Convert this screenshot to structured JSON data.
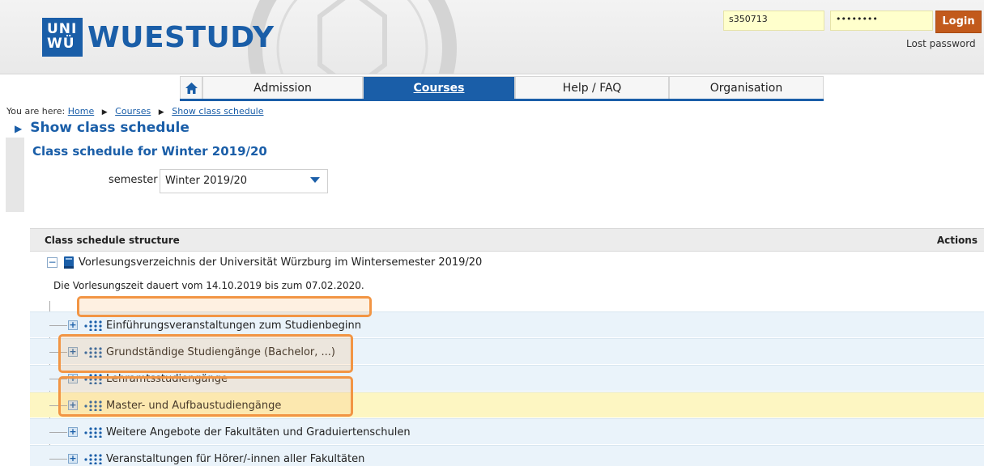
{
  "header": {
    "logo_box": "UNI WÜ",
    "logo_text": "WUESTUDY",
    "username_value": "s350713",
    "password_value": "••••••••",
    "login_label": "Login",
    "lost_password": "Lost password"
  },
  "nav": {
    "items": [
      {
        "label": "Admission"
      },
      {
        "label": "Courses"
      },
      {
        "label": "Help / FAQ"
      },
      {
        "label": "Organisation"
      }
    ]
  },
  "breadcrumb": {
    "prefix": "You are here:",
    "items": [
      "Home",
      "Courses",
      "Show class schedule"
    ]
  },
  "page": {
    "title": "Show class schedule",
    "section_title": "Class schedule for Winter 2019/20",
    "semester_label": "semester",
    "semester_value": "Winter 2019/20"
  },
  "structure": {
    "header_label": "Class schedule structure",
    "actions_label": "Actions",
    "root_label": "Vorlesungsverzeichnis der Universität Würzburg im Wintersemester 2019/20",
    "root_desc": "Die Vorlesungszeit dauert vom 14.10.2019 bis zum 07.02.2020.",
    "rows": [
      {
        "label": "Einführungsveranstaltungen zum Studienbeginn"
      },
      {
        "label": "Grundständige Studiengänge (Bachelor, ...)"
      },
      {
        "label": "Lehramtsstudiengänge"
      },
      {
        "label": "Master- und Aufbaustudiengänge"
      },
      {
        "label": "Weitere Angebote der Fakultäten und Graduiertenschulen"
      },
      {
        "label": "Veranstaltungen für Hörer/-innen aller Fakultäten"
      }
    ]
  },
  "colors": {
    "brand_blue": "#1a5ea8",
    "login_orange": "#c25a1c",
    "highlight_orange": "#f29544",
    "row_blue_bg": "#eaf3fa",
    "row_yellow_bg": "#fdf6c2"
  }
}
